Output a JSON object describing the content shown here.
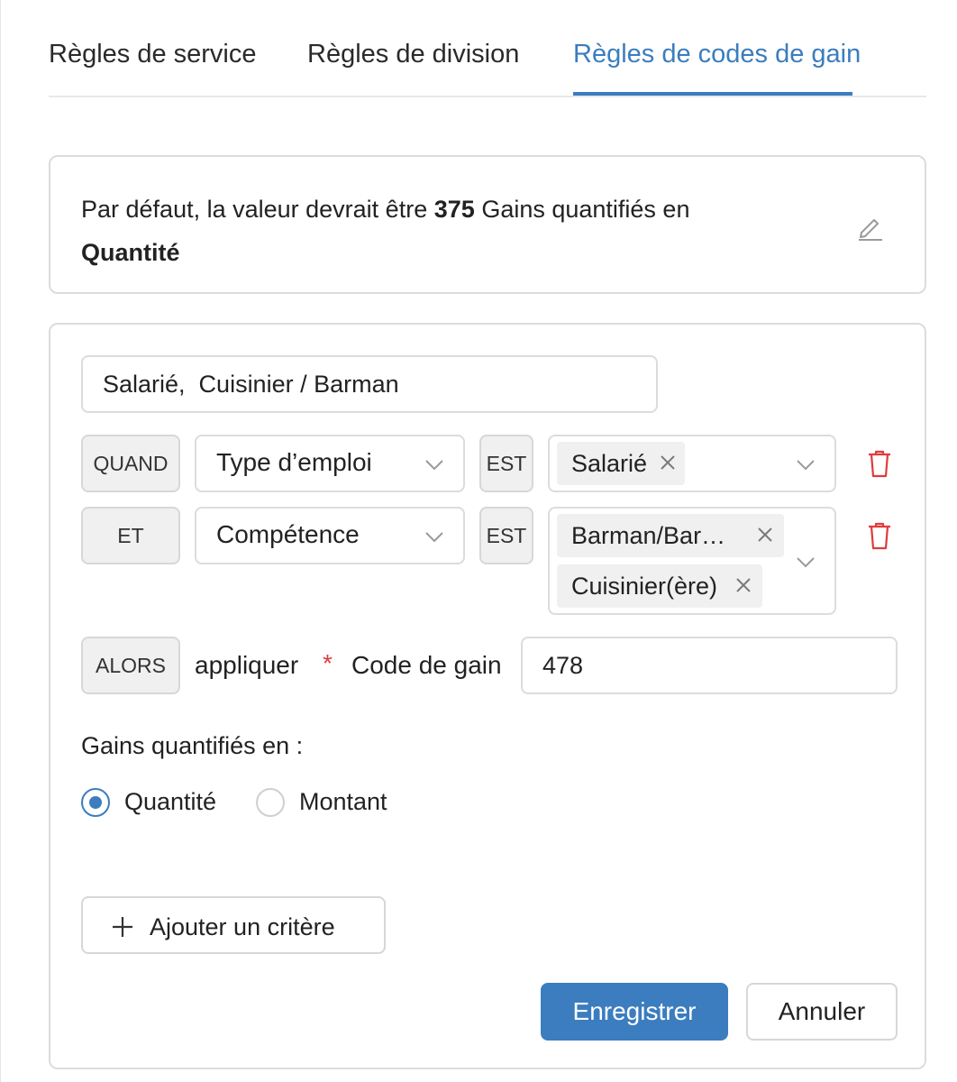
{
  "tabs": [
    {
      "label": "Règles de service"
    },
    {
      "label": "Règles de division"
    },
    {
      "label": "Règles de codes de gain",
      "active": true
    }
  ],
  "default_rule": {
    "prefix": "Par défaut, la valeur devrait être",
    "value": "375",
    "middle": "Gains quantifiés en",
    "unit": "Quantité",
    "edit_icon": "pencil-icon"
  },
  "rule": {
    "name": "Salarié,  Cuisinier / Barman",
    "conditions": [
      {
        "connector": "QUAND",
        "field": "Type d’emploi",
        "operator": "EST",
        "values": [
          "Salarié"
        ]
      },
      {
        "connector": "ET",
        "field": "Compétence",
        "operator": "EST",
        "values": [
          "Barman/Bar…",
          "Cuisinier(ère)"
        ]
      }
    ],
    "action": {
      "connector": "ALORS",
      "verb": "appliquer",
      "required_mark": "*",
      "label": "Code de gain",
      "value": "478"
    },
    "gains": {
      "label": "Gains quantifiés en :",
      "options": [
        "Quantité",
        "Montant"
      ],
      "selected": "Quantité"
    },
    "add_criteria_label": "Ajouter un critère",
    "save_label": "Enregistrer",
    "cancel_label": "Annuler"
  },
  "colors": {
    "accent": "#3b7dbf",
    "danger": "#e03b3b",
    "border": "#dcdcdc",
    "tag_bg": "#f0f0f0"
  }
}
